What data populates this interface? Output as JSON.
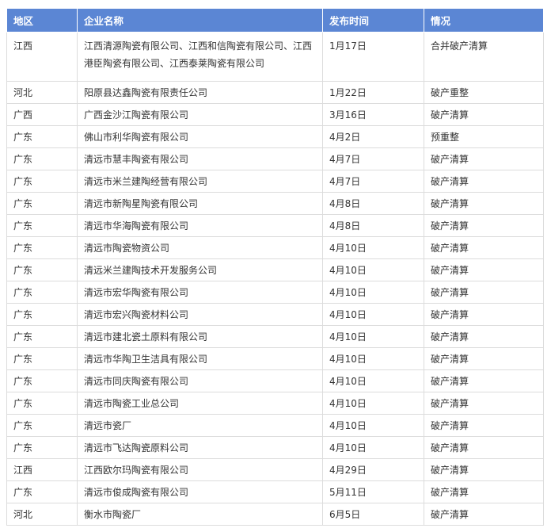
{
  "table": {
    "headers": [
      "地区",
      "企业名称",
      "发布时间",
      "情况"
    ],
    "rows": [
      [
        "江西",
        "江西清源陶瓷有限公司、江西和信陶瓷有限公司、江西港臣陶瓷有限公司、江西泰莱陶瓷有限公司",
        "1月17日",
        "合并破产清算"
      ],
      [
        "河北",
        "阳原县达鑫陶瓷有限责任公司",
        "1月22日",
        "破产重整"
      ],
      [
        "广西",
        "广西金沙江陶瓷有限公司",
        "3月16日",
        "破产清算"
      ],
      [
        "广东",
        "佛山市利华陶瓷有限公司",
        "4月2日",
        "预重整"
      ],
      [
        "广东",
        "清远市慧丰陶瓷有限公司",
        "4月7日",
        "破产清算"
      ],
      [
        "广东",
        "清远市米兰建陶经营有限公司",
        "4月7日",
        "破产清算"
      ],
      [
        "广东",
        "清远市新陶星陶瓷有限公司",
        "4月8日",
        "破产清算"
      ],
      [
        "广东",
        "清远市华海陶瓷有限公司",
        "4月8日",
        "破产清算"
      ],
      [
        "广东",
        "清远市陶瓷物资公司",
        "4月10日",
        "破产清算"
      ],
      [
        "广东",
        "清远米兰建陶技术开发服务公司",
        "4月10日",
        "破产清算"
      ],
      [
        "广东",
        "清远市宏华陶瓷有限公司",
        "4月10日",
        "破产清算"
      ],
      [
        "广东",
        "清远市宏兴陶瓷材料公司",
        "4月10日",
        "破产清算"
      ],
      [
        "广东",
        "清远市建北瓷土原料有限公司",
        "4月10日",
        "破产清算"
      ],
      [
        "广东",
        "清远市华陶卫生洁具有限公司",
        "4月10日",
        "破产清算"
      ],
      [
        "广东",
        "清远市同庆陶瓷有限公司",
        "4月10日",
        "破产清算"
      ],
      [
        "广东",
        "清远市陶瓷工业总公司",
        "4月10日",
        "破产清算"
      ],
      [
        "广东",
        "清远市瓷厂",
        "4月10日",
        "破产清算"
      ],
      [
        "广东",
        "清远市飞达陶瓷原料公司",
        "4月10日",
        "破产清算"
      ],
      [
        "江西",
        "江西欧尔玛陶瓷有限公司",
        "4月29日",
        "破产清算"
      ],
      [
        "广东",
        "清远市俊成陶瓷有限公司",
        "5月11日",
        "破产清算"
      ],
      [
        "河北",
        "衡水市陶瓷厂",
        "6月5日",
        "破产清算"
      ]
    ]
  }
}
